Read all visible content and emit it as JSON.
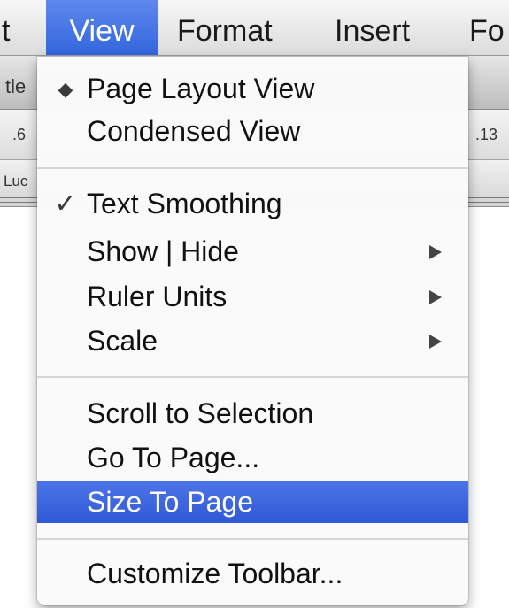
{
  "menubar": {
    "items": [
      {
        "label": "t"
      },
      {
        "label": "View"
      },
      {
        "label": "Format"
      },
      {
        "label": "Insert"
      },
      {
        "label": "Fo"
      }
    ]
  },
  "background": {
    "title_fragment": "tle",
    "ruler_left": ".6",
    "ruler_right": ".13",
    "font_fragment": "Luc"
  },
  "view_menu": {
    "items": [
      {
        "label": "Page Layout View",
        "mark": "diamond"
      },
      {
        "label": "Condensed View"
      },
      {
        "label": "Text Smoothing",
        "mark": "check"
      },
      {
        "label": "Show | Hide",
        "submenu": true
      },
      {
        "label": "Ruler Units",
        "submenu": true
      },
      {
        "label": "Scale",
        "submenu": true
      },
      {
        "label": "Scroll to Selection"
      },
      {
        "label": "Go To Page..."
      },
      {
        "label": "Size To Page",
        "highlighted": true
      },
      {
        "label": "Customize Toolbar..."
      }
    ],
    "marks": {
      "diamond": "◆",
      "check": "✓"
    }
  },
  "colors": {
    "highlight": "#3a62dc",
    "menubar_active": "#4677e6"
  }
}
